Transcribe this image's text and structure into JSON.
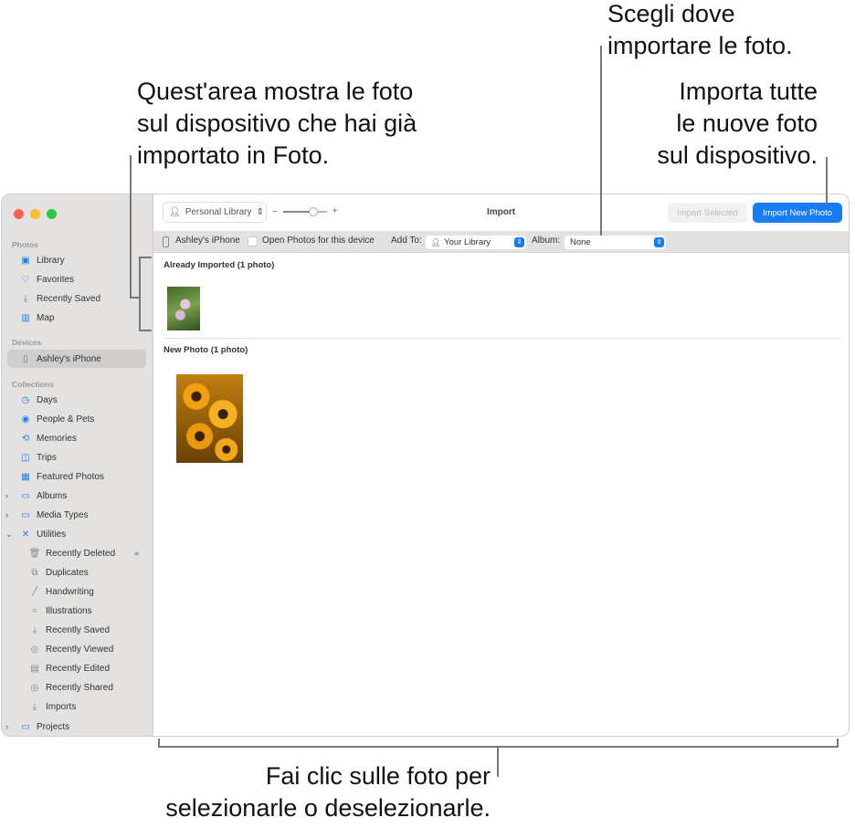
{
  "callouts": {
    "already_imported": [
      "Quest'area mostra le foto",
      "sul dispositivo che hai già",
      "importato in Foto."
    ],
    "destination": [
      "Scegli dove",
      "importare le foto."
    ],
    "import_all": [
      "Importa tutte",
      "le nuove foto",
      "sul dispositivo."
    ],
    "select": [
      "Fai clic sulle foto per",
      "selezionarle o deselezionarle."
    ]
  },
  "sidebar": {
    "sections": {
      "photos": "Photos",
      "devices": "Devices",
      "collections": "Collections"
    },
    "photos": [
      "Library",
      "Favorites",
      "Recently Saved",
      "Map"
    ],
    "device": "Ashley's iPhone",
    "collections": [
      "Days",
      "People & Pets",
      "Memories",
      "Trips",
      "Featured Photos",
      "Albums",
      "Media Types",
      "Utilities"
    ],
    "utilities": [
      "Recently Deleted",
      "Duplicates",
      "Handwriting",
      "Illustrations",
      "Recently Saved",
      "Recently Viewed",
      "Recently Edited",
      "Recently Shared",
      "Imports"
    ],
    "projects": "Projects"
  },
  "toolbar": {
    "library": "Personal Library",
    "zoom_minus": "–",
    "zoom_plus": "+",
    "zoom_level": 0.6,
    "title": "Import",
    "import_selected": "Import Selected",
    "import_new": "Import New Photo"
  },
  "importbar": {
    "device": "Ashley's iPhone",
    "open_photos": "Open Photos for this device",
    "open_photos_checked": false,
    "add_to_label": "Add To:",
    "add_to_value": "Your Library",
    "album_label": "Album:",
    "album_value": "None"
  },
  "content": {
    "already_imported": "Already Imported (1 photo)",
    "new_photo": "New Photo (1 photo)"
  },
  "colors": {
    "accent": "#1a7cf5",
    "sidebar": "#e3e2e1"
  }
}
